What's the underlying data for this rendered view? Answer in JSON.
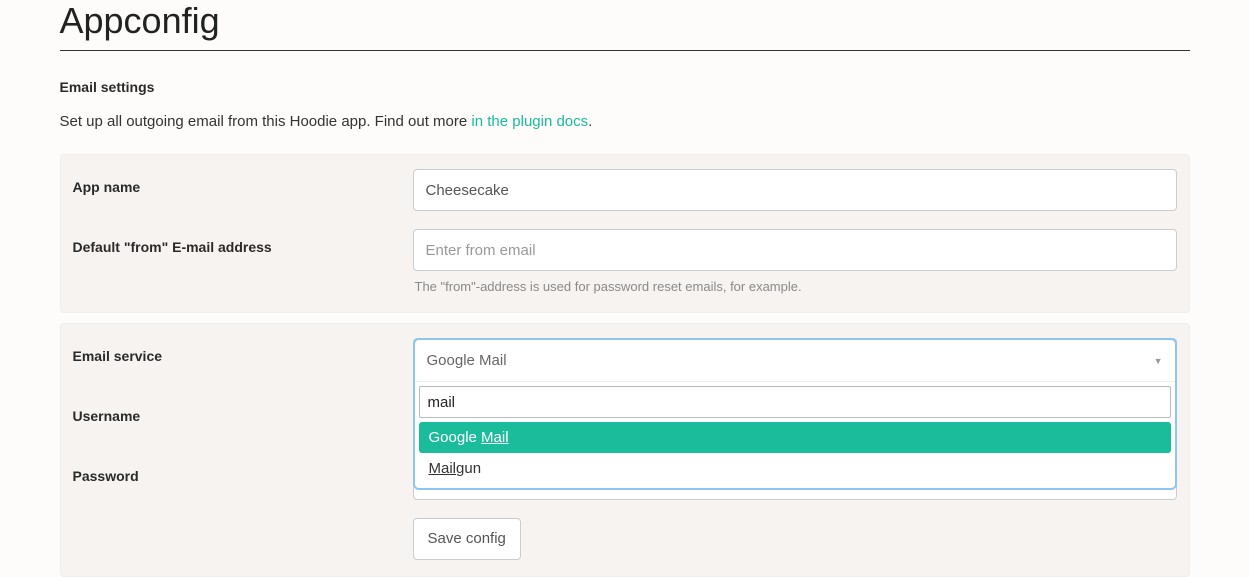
{
  "page": {
    "title": "Appconfig",
    "section_title": "Email settings",
    "intro_text": "Set up all outgoing email from this Hoodie app. Find out more ",
    "intro_link": "in the plugin docs",
    "intro_suffix": "."
  },
  "form": {
    "app_name": {
      "label": "App name",
      "value": "Cheesecake"
    },
    "from_email": {
      "label": "Default \"from\" E-mail address",
      "placeholder": "Enter from email",
      "value": "",
      "help": "The \"from\"-address is used for password reset emails, for example."
    },
    "email_service": {
      "label": "Email service",
      "selected": "Google Mail",
      "search_value": "mail",
      "options": [
        {
          "label_pre": "Google ",
          "label_match": "Mail",
          "label_post": "",
          "highlight": true
        },
        {
          "label_pre": "",
          "label_match": "Mail",
          "label_post": "gun",
          "highlight": false
        }
      ]
    },
    "username": {
      "label": "Username"
    },
    "password": {
      "label": "Password"
    },
    "save_label": "Save config"
  }
}
